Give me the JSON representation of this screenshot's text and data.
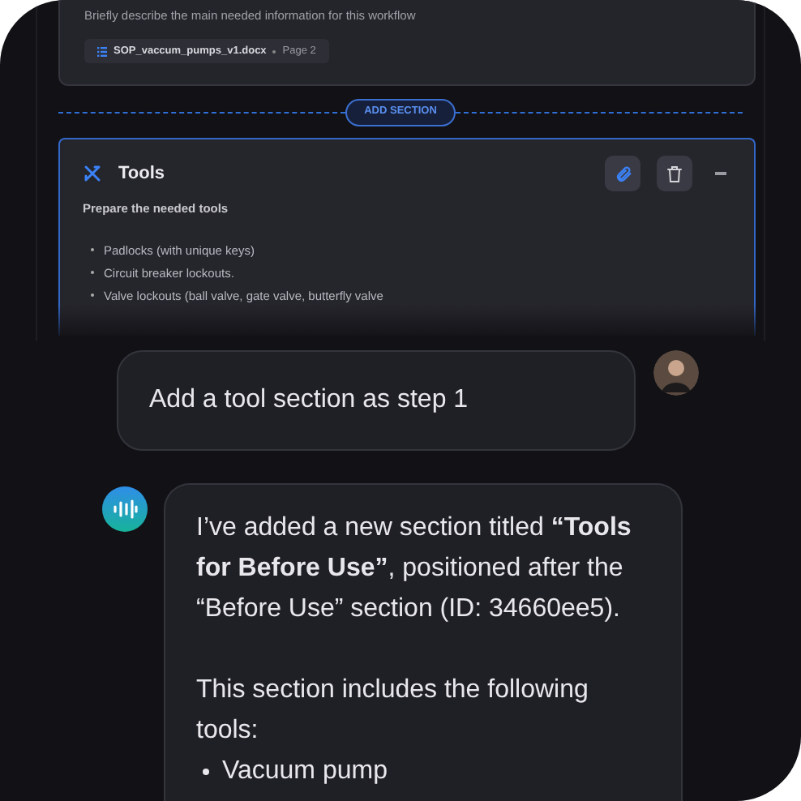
{
  "workflow_card": {
    "description": "Briefly describe the main needed information for this workflow",
    "source": {
      "file": "SOP_vaccum_pumps_v1.docx",
      "page": "Page 2"
    }
  },
  "add_section": {
    "label": "ADD SECTION"
  },
  "tools_section": {
    "title": "Tools",
    "subtitle": "Prepare the needed tools",
    "items": [
      "Padlocks (with unique keys)",
      "Circuit breaker lockouts.",
      "Valve lockouts (ball valve, gate valve, butterfly valve"
    ]
  },
  "chat": [
    {
      "kind": "user",
      "text": "Add a tool section as step 1"
    },
    {
      "kind": "assistant",
      "paragraphs": [
        "I’ve added a new section titled **“Tools for Before Use”**, positioned after the “Before Use” section (ID: 34660ee5).",
        "This section includes the following tools:"
      ],
      "items": [
        "Vacuum pump"
      ]
    }
  ]
}
